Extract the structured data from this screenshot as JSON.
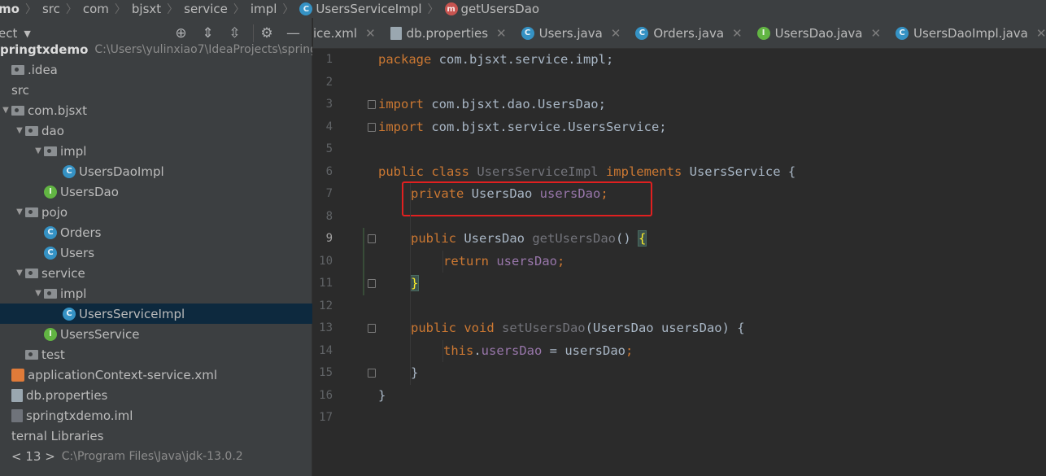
{
  "breadcrumb": {
    "items": [
      {
        "label": "mo",
        "icon": ""
      },
      {
        "label": "src",
        "icon": ""
      },
      {
        "label": "com",
        "icon": ""
      },
      {
        "label": "bjsxt",
        "icon": ""
      },
      {
        "label": "service",
        "icon": ""
      },
      {
        "label": "impl",
        "icon": ""
      },
      {
        "label": "UsersServiceImpl",
        "icon": "class-icon"
      },
      {
        "label": "getUsersDao",
        "icon": "method-icon"
      }
    ]
  },
  "project_panel": {
    "title": "ect",
    "tree": [
      {
        "label": "pringtxdemo",
        "hint": "C:\\Users\\yulinxiao7\\IdeaProjects\\spring",
        "icon": "none",
        "arrow": "",
        "indent": 0,
        "bold": true
      },
      {
        "label": ".idea",
        "icon": "folder",
        "arrow": "",
        "indent": 0
      },
      {
        "label": "src",
        "icon": "none",
        "arrow": "",
        "indent": 0
      },
      {
        "label": "com.bjsxt",
        "icon": "folder",
        "arrow": "down",
        "indent": 0
      },
      {
        "label": "dao",
        "icon": "folder",
        "arrow": "down",
        "indent": 1
      },
      {
        "label": "impl",
        "icon": "folder",
        "arrow": "down",
        "indent": 2
      },
      {
        "label": "UsersDaoImpl",
        "icon": "class",
        "arrow": "",
        "indent": 3
      },
      {
        "label": "UsersDao",
        "icon": "interface",
        "arrow": "",
        "indent": 2
      },
      {
        "label": "pojo",
        "icon": "folder",
        "arrow": "down",
        "indent": 1
      },
      {
        "label": "Orders",
        "icon": "class",
        "arrow": "",
        "indent": 2
      },
      {
        "label": "Users",
        "icon": "class",
        "arrow": "",
        "indent": 2
      },
      {
        "label": "service",
        "icon": "folder",
        "arrow": "down",
        "indent": 1
      },
      {
        "label": "impl",
        "icon": "folder",
        "arrow": "down",
        "indent": 2
      },
      {
        "label": "UsersServiceImpl",
        "icon": "class",
        "arrow": "",
        "indent": 3,
        "selected": true
      },
      {
        "label": "UsersService",
        "icon": "interface",
        "arrow": "",
        "indent": 2
      },
      {
        "label": "test",
        "icon": "folder",
        "arrow": "",
        "indent": 1
      },
      {
        "label": "applicationContext-service.xml",
        "icon": "xml",
        "arrow": "",
        "indent": 0
      },
      {
        "label": "db.properties",
        "icon": "properties",
        "arrow": "",
        "indent": 0
      },
      {
        "label": "springtxdemo.iml",
        "icon": "iml",
        "arrow": "",
        "indent": 0
      },
      {
        "label": "ternal Libraries",
        "icon": "none",
        "arrow": "",
        "indent": 0
      },
      {
        "label": "< 13 >",
        "hint": "C:\\Program Files\\Java\\jdk-13.0.2",
        "icon": "none",
        "arrow": "",
        "indent": 0
      }
    ]
  },
  "tabs": [
    {
      "label": "ice.xml",
      "icon": "none"
    },
    {
      "label": "db.properties",
      "icon": "properties"
    },
    {
      "label": "Users.java",
      "icon": "class"
    },
    {
      "label": "Orders.java",
      "icon": "class"
    },
    {
      "label": "UsersDao.java",
      "icon": "interface"
    },
    {
      "label": "UsersDaoImpl.java",
      "icon": "class"
    }
  ],
  "editor": {
    "line_numbers": [
      "1",
      "2",
      "3",
      "4",
      "5",
      "6",
      "7",
      "8",
      "9",
      "10",
      "11",
      "12",
      "13",
      "14",
      "15",
      "16",
      "17"
    ],
    "current_line": "9",
    "lines": {
      "l1": {
        "kw": "package",
        "rest": " com.bjsxt.service.impl;"
      },
      "l3": {
        "kw": "import",
        "rest": " com.bjsxt.dao.UsersDao;"
      },
      "l4": {
        "kw": "import",
        "rest": " com.bjsxt.service.UsersService;"
      },
      "l6": {
        "kw1": "public class",
        "cls": " UsersServiceImpl",
        "kw2": " implements",
        "rest": " UsersService {"
      },
      "l7": {
        "kw": "private",
        "type": " UsersDao",
        "field": " usersDao",
        "end": ";"
      },
      "l9": {
        "kw": "public",
        "type": " UsersDao",
        "method": " getUsersDao",
        "paren": "() ",
        "brace": "{"
      },
      "l10": {
        "kw": "return",
        "field": " usersDao",
        "end": ";"
      },
      "l11": {
        "brace": "}"
      },
      "l13": {
        "kw": "public void",
        "method": " setUsersDao",
        "rest": "(UsersDao usersDao) {"
      },
      "l14": {
        "kw": "this",
        "dot": ".",
        "field": "usersDao",
        "rest": " = usersDao",
        "end": ";"
      },
      "l15": {
        "brace": "}"
      },
      "l16": {
        "brace": "}"
      }
    }
  },
  "colors": {
    "keyword": "#cc7832",
    "field": "#9876aa",
    "plain": "#a9b7c6",
    "highlight_box": "#e02020",
    "selection": "#0d293e"
  }
}
